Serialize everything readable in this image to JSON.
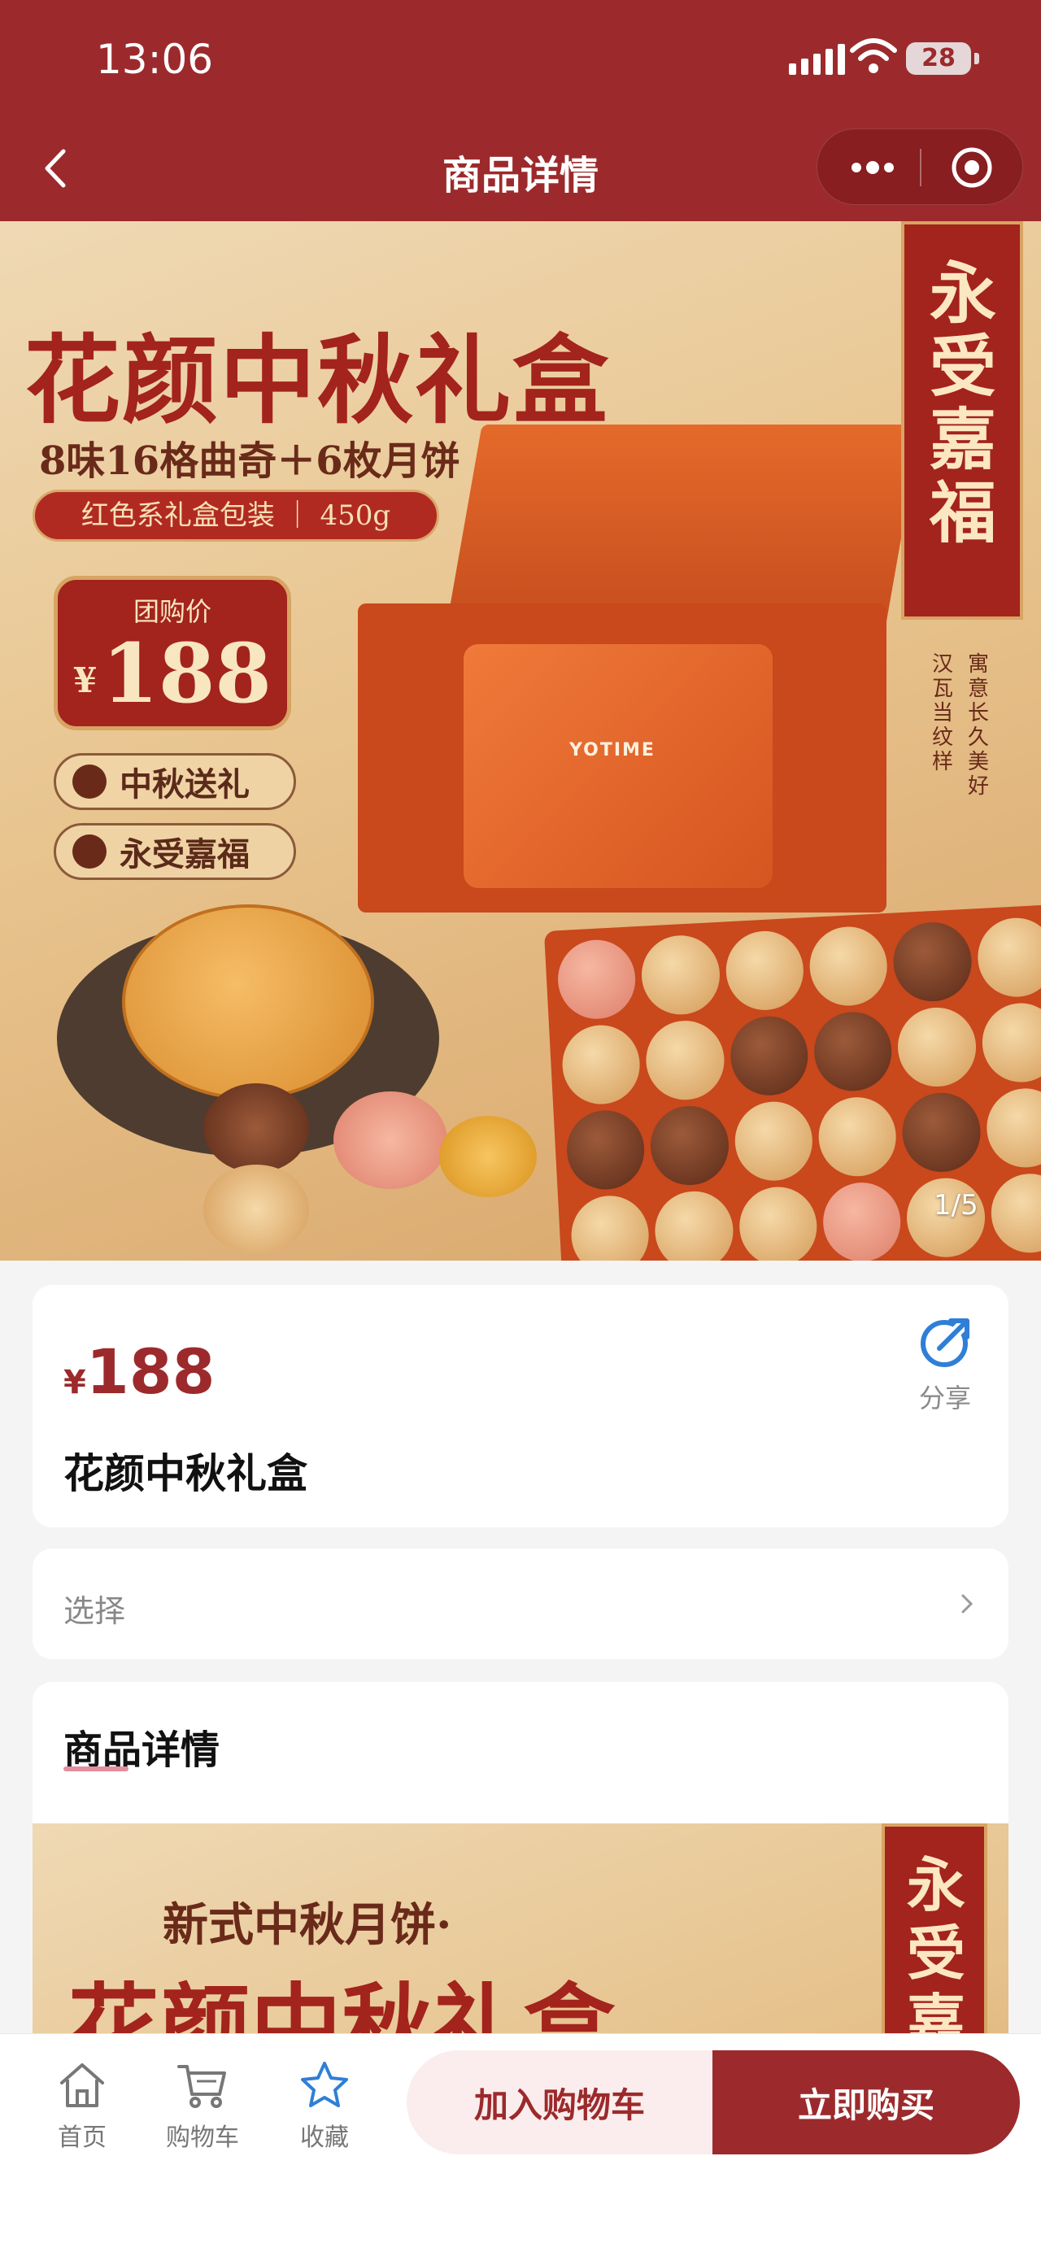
{
  "status_bar": {
    "time": "13:06",
    "battery": "28"
  },
  "nav": {
    "title": "商品详情"
  },
  "hero": {
    "title": "花颜中秋礼盒",
    "subtitle": "8味16格曲奇＋6枚月饼",
    "pill": "红色系礼盒包装 ｜ 450g",
    "price_label": "团购价",
    "price_currency": "¥",
    "price_value": "188",
    "tag1": "中秋送礼",
    "tag2": "永受嘉福",
    "banner": "永受嘉福",
    "vertical1": "汉瓦当纹样",
    "vertical2": "寓意长久美好",
    "brand": "YOTIME",
    "counter": "1/5"
  },
  "product": {
    "currency": "¥",
    "price": "188",
    "name": "花颜中秋礼盒",
    "share_label": "分享"
  },
  "select": {
    "label": "选择"
  },
  "detail": {
    "title": "商品详情",
    "image_sub": "新式中秋月饼·",
    "image_title": "花颜中秋礼盒",
    "image_banner": "永受嘉"
  },
  "bottom": {
    "home": "首页",
    "cart": "购物车",
    "favorite": "收藏",
    "add_to_cart": "加入购物车",
    "buy_now": "立即购买"
  },
  "colors": {
    "brand": "#9c2a2c",
    "accent_blue": "#2f7fd6"
  }
}
